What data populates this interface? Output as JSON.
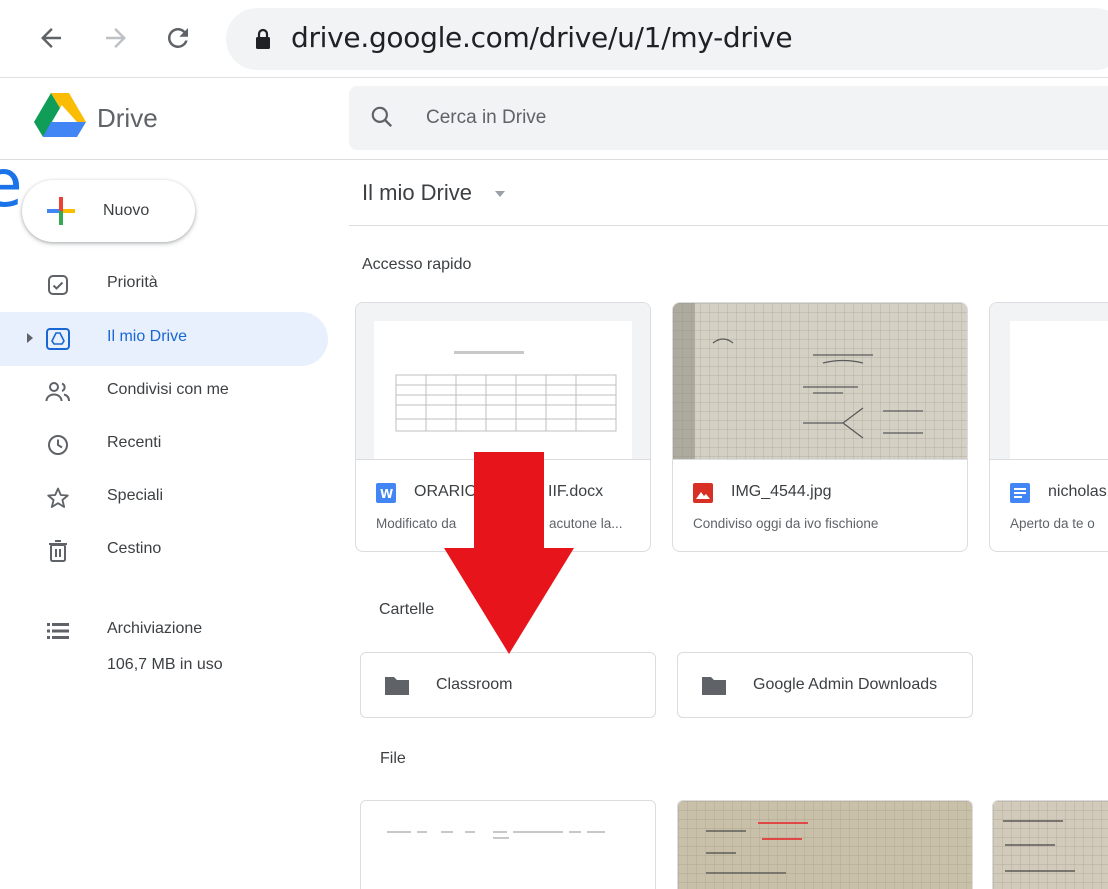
{
  "browser": {
    "url": "drive.google.com/drive/u/1/my-drive"
  },
  "header": {
    "app_name": "Drive",
    "search_placeholder": "Cerca in Drive"
  },
  "stray_glyph": "e",
  "sidebar": {
    "new_button": "Nuovo",
    "items": [
      {
        "label": "Priorità",
        "icon": "priority-check-icon"
      },
      {
        "label": "Il mio Drive",
        "icon": "my-drive-icon",
        "active": true
      },
      {
        "label": "Condivisi con me",
        "icon": "shared-people-icon"
      },
      {
        "label": "Recenti",
        "icon": "clock-icon"
      },
      {
        "label": "Speciali",
        "icon": "star-icon"
      },
      {
        "label": "Cestino",
        "icon": "trash-icon"
      }
    ],
    "storage": {
      "label": "Archiviazione",
      "usage": "106,7 MB in uso"
    }
  },
  "main": {
    "title": "Il mio Drive",
    "quick_access_label": "Accesso rapido",
    "quick_access": [
      {
        "name": "ORARIO",
        "name_tail": "IIF.docx",
        "meta": "Modificato da",
        "meta_tail": "acutone la...",
        "type": "word",
        "icon_color": "#4285f4"
      },
      {
        "name": "IMG_4544.jpg",
        "meta": "Condiviso oggi da ivo fischione",
        "type": "image",
        "icon_color": "#d93025"
      },
      {
        "name": "nicholas",
        "meta": "Aperto da te o",
        "type": "doc",
        "icon_color": "#4285f4"
      }
    ],
    "folders_label": "Cartelle",
    "folders": [
      {
        "name": "Classroom"
      },
      {
        "name": "Google Admin Downloads"
      }
    ],
    "files_label": "File"
  },
  "colors": {
    "accent": "#1a73e8",
    "active_bg": "#e8f0fe",
    "arrow": "#e8141c"
  }
}
